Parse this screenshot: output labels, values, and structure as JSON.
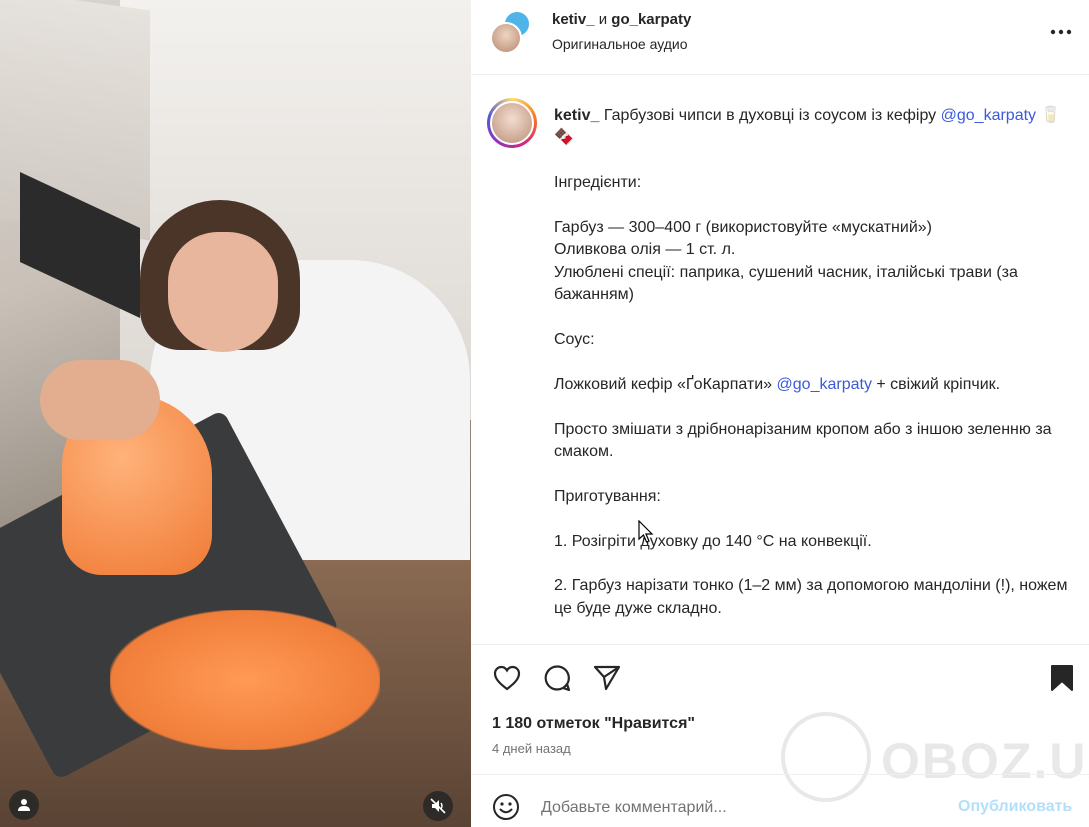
{
  "header": {
    "user1": "ketiv_",
    "conjunction": "и",
    "user2": "go_karpaty",
    "audio": "Оригинальное аудио"
  },
  "caption": {
    "username": "ketiv_",
    "title": "Гарбузові чипси в духовці із соусом із кефіру",
    "mention": "@go_karpaty",
    "emoji": "🥛 🍫",
    "ingredients_heading": "Інгредієнти:",
    "ingredient1": "Гарбуз — 300–400 г (використовуйте «мускатний»)",
    "ingredient2": "Оливкова олія — 1 ст. л.",
    "ingredient3": "Улюблені спеції: паприка, сушений часник, італійські трави (за бажанням)",
    "sauce_heading": "Соус:",
    "sauce_line_pre": "Ложковий кефір «ҐоКарпати»",
    "sauce_mention": "@go_karpaty",
    "sauce_line_post": "+ свіжий кріпчик.",
    "sauce_instr": "Просто змішати з дрібнонарізаним кропом або з іншою зеленню за смаком.",
    "prep_heading": "Приготування:",
    "step1": "1. Розігріти духовку до 140 °C на конвекції.",
    "step2": "2. Гарбуз нарізати тонко (1–2 мм) за допомогою мандоліни (!), ножем це буде дуже складно."
  },
  "stats": {
    "likes": "1 180 отметок \"Нравится\"",
    "time": "4 дней назад"
  },
  "comment": {
    "placeholder": "Добавьте комментарий...",
    "post_label": "Опубликовать"
  },
  "watermark": {
    "text": "OBOZ.UA"
  },
  "icons": {
    "like": "heart-icon",
    "comment": "comment-icon",
    "share": "send-icon",
    "save": "bookmark-icon",
    "more": "more-icon",
    "emoji": "emoji-icon",
    "tag": "user-tag-icon",
    "mute": "muted-speaker-icon"
  },
  "colors": {
    "mention": "#3b5bdb",
    "post_button": "#b2dffc",
    "muted_text": "#737373"
  }
}
